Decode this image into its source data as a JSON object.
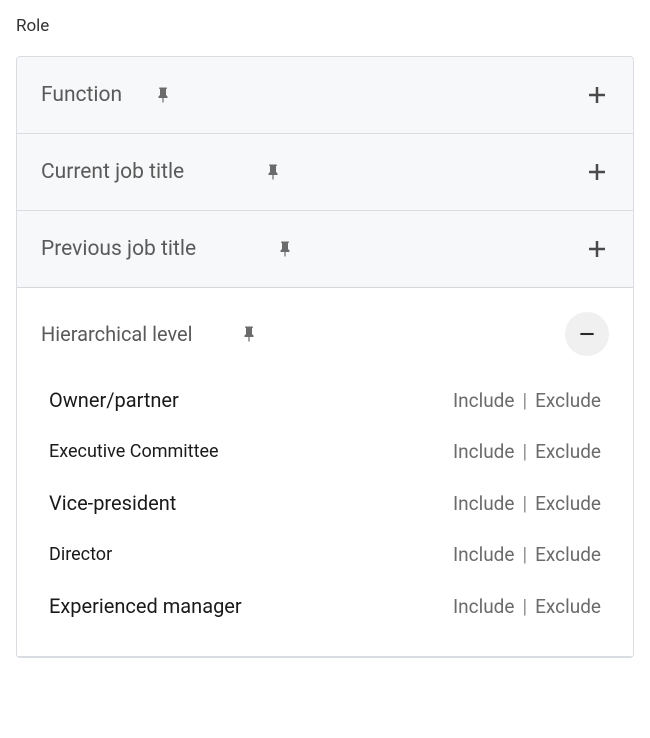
{
  "section": {
    "title": "Role"
  },
  "filters": [
    {
      "label": "Function"
    },
    {
      "label": "Current job title"
    },
    {
      "label": "Previous job title"
    }
  ],
  "expanded_filter": {
    "label": "Hierarchical level",
    "options": [
      {
        "label": "Owner/partner",
        "size": "normal"
      },
      {
        "label": "Executive Committee",
        "size": "small"
      },
      {
        "label": "Vice-president",
        "size": "normal"
      },
      {
        "label": "Director",
        "size": "small"
      },
      {
        "label": "Experienced manager",
        "size": "normal"
      }
    ]
  },
  "actions": {
    "include": "Include",
    "exclude": "Exclude"
  }
}
